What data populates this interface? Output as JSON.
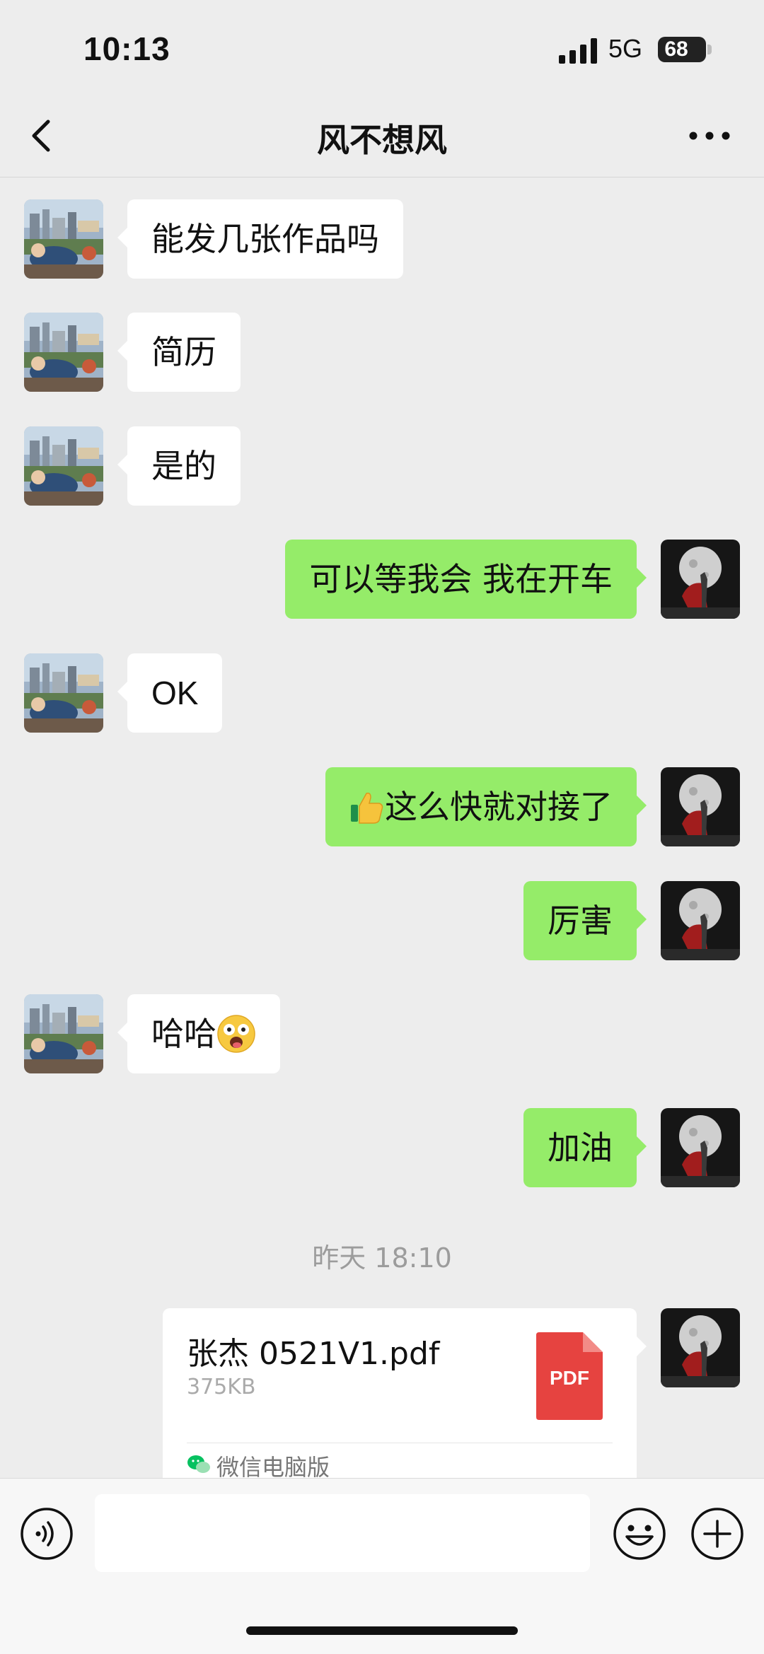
{
  "status_bar": {
    "time": "10:13",
    "network": "5G",
    "battery": "68"
  },
  "header": {
    "title": "风不想风"
  },
  "messages": [
    {
      "side": "in",
      "text": "能发几张作品吗"
    },
    {
      "side": "in",
      "text": "简历"
    },
    {
      "side": "in",
      "text": "是的"
    },
    {
      "side": "out",
      "text": "可以等我会 我在开车"
    },
    {
      "side": "in",
      "text": "OK"
    },
    {
      "side": "out",
      "emoji": "thumbs-up",
      "text": "这么快就对接了"
    },
    {
      "side": "out",
      "text": "厉害"
    },
    {
      "side": "in",
      "text": "哈哈",
      "emoji_after": "dizzy-face"
    },
    {
      "side": "out",
      "text": "加油"
    }
  ],
  "timestamp": "昨天 18:10",
  "file_message": {
    "name": "张杰 0521V1.pdf",
    "size": "375KB",
    "type_label": "PDF",
    "source": "微信电脑版"
  },
  "input_bar": {
    "placeholder": ""
  },
  "colors": {
    "background": "#ededed",
    "outgoing_bubble": "#95ec69",
    "incoming_bubble": "#ffffff",
    "pdf_red": "#e64340",
    "wechat_green": "#07c160"
  }
}
